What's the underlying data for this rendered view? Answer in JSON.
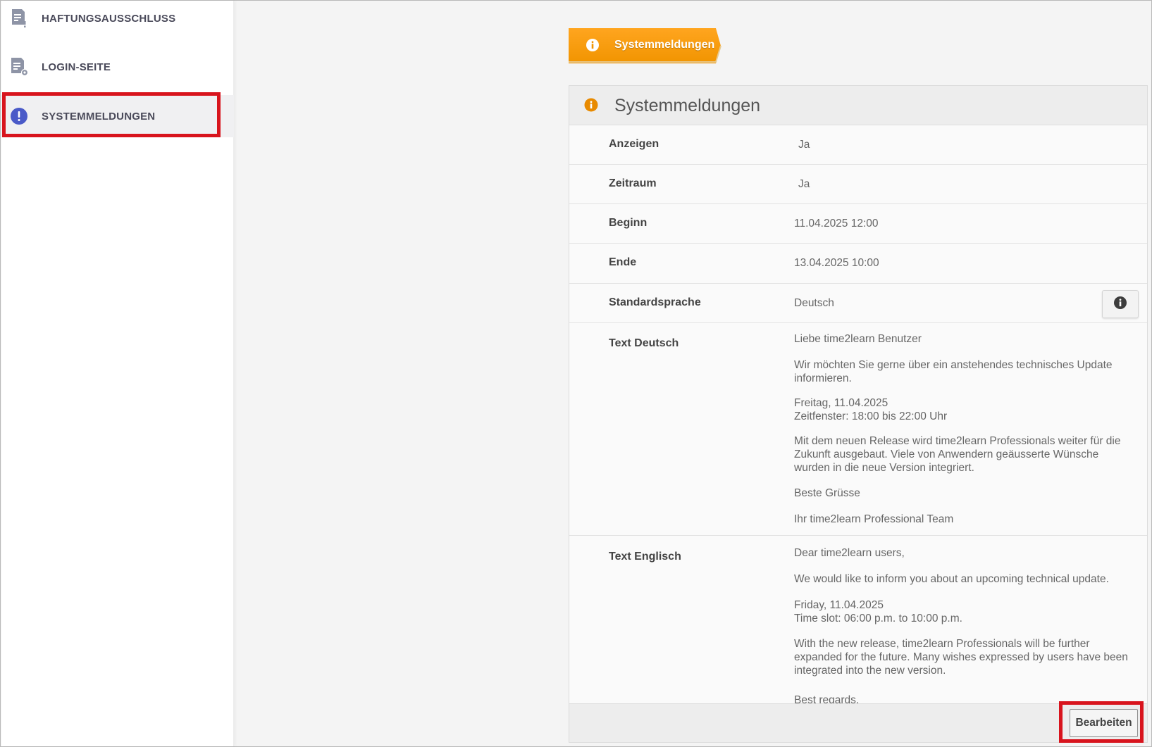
{
  "sidebar": {
    "items": [
      {
        "label": "HAFTUNGSAUSSCHLUSS",
        "icon": "document-warning-icon"
      },
      {
        "label": "LOGIN-SEITE",
        "icon": "document-settings-icon"
      },
      {
        "label": "SYSTEMMELDUNGEN",
        "icon": "exclamation-circle-icon",
        "active": true
      }
    ]
  },
  "breadcrumb": {
    "label": "Systemmeldungen",
    "icon": "info-circle-icon",
    "color": "#f5a300"
  },
  "panel": {
    "title": "Systemmeldungen",
    "icon": "info-circle-icon",
    "rows": [
      {
        "key": "Anzeigen",
        "value": "Ja"
      },
      {
        "key": "Zeitraum",
        "value": "Ja"
      },
      {
        "key": "Beginn",
        "value": "11.04.2025 12:00"
      },
      {
        "key": "Ende",
        "value": "13.04.2025 10:00"
      },
      {
        "key": "Standardsprache",
        "value": "Deutsch"
      }
    ],
    "text_de": {
      "key": "Text Deutsch",
      "paragraphs": [
        "Liebe time2learn Benutzer",
        "Wir möchten Sie gerne über ein anstehendes technisches Update informieren.",
        "Freitag, 11.04.2025\nZeitfenster: 18:00 bis 22:00 Uhr",
        "Mit dem neuen Release wird time2learn Professionals weiter für die Zukunft ausgebaut. Viele von Anwendern geäusserte Wünsche wurden in die neue Version integriert.",
        "Beste Grüsse",
        "Ihr time2learn Professional Team"
      ]
    },
    "text_en": {
      "key": "Text Englisch",
      "paragraphs": [
        "Dear time2learn users,",
        "We would like to inform you about an upcoming technical update.",
        "Friday, 11.04.2025\nTime slot: 06:00 p.m. to 10:00 p.m.",
        "With the new release, time2learn Professionals will be further expanded for the future. Many wishes expressed by users have been integrated into the new version.",
        "Best regards,"
      ]
    },
    "edit_label": "Bearbeiten"
  },
  "colors": {
    "accent": "#f5a300",
    "nav_icon": "#4a5ac8",
    "highlight": "#d8141d"
  }
}
